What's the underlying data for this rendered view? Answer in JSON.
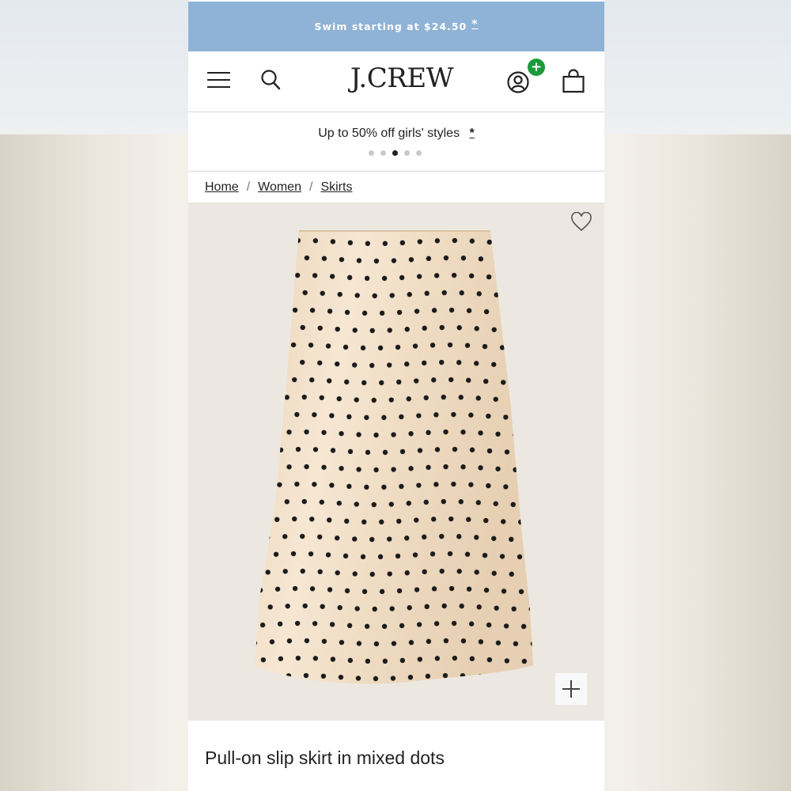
{
  "promo": {
    "text": "Swim starting at $24.50",
    "star": "*",
    "background": "#8fb3d6"
  },
  "header": {
    "logo": "J.CREW",
    "icons": [
      "menu-icon",
      "search-icon",
      "account-icon",
      "plus-icon",
      "shopping-bag-icon"
    ],
    "badge_color": "#1a9a3a"
  },
  "carousel": {
    "text": "Up to 50% off girls' styles",
    "star": "*",
    "slide_count": 5,
    "active_index": 2
  },
  "breadcrumb": {
    "items": [
      "Home",
      "Women",
      "Skirts"
    ],
    "separator": "/"
  },
  "product": {
    "title": "Pull-on slip skirt in mixed dots",
    "fabric_color": "#f0dcc2",
    "dot_color": "#1c1c1c"
  }
}
